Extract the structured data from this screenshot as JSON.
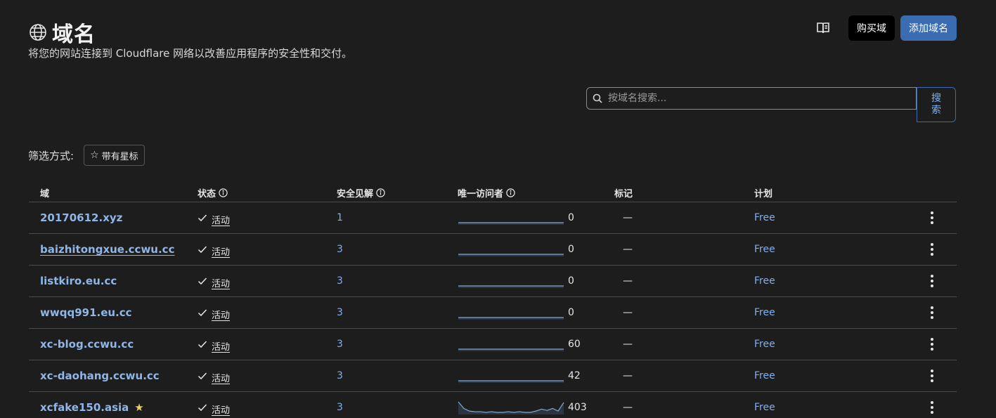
{
  "header": {
    "title": "域名",
    "subtitle": "将您的网站连接到 Cloudflare 网络以改善应用程序的安全性和交付。",
    "icon": "globe-icon",
    "docs_icon": "book-icon",
    "buy_domain_label": "购买域",
    "add_domain_label": "添加域名"
  },
  "search": {
    "placeholder": "按域名搜索...",
    "button_label": "搜索",
    "icon": "search-icon"
  },
  "filter": {
    "label": "筛选方式:",
    "chip_label": "带有星标"
  },
  "table": {
    "columns": {
      "domain": "域",
      "status": "状态",
      "insights": "安全见解",
      "visitors": "唯一访问者",
      "tags": "标记",
      "plan": "计划"
    },
    "rows": [
      {
        "domain": "20170612.xyz",
        "status": "活动",
        "insights": "1",
        "visitors": "0",
        "tags": "—",
        "plan": "Free",
        "starred": false,
        "underline": false,
        "spark": [
          0,
          0,
          0,
          0,
          0,
          0,
          0,
          0,
          0,
          0,
          0,
          0,
          0,
          0,
          0,
          0,
          0,
          0,
          0,
          0
        ]
      },
      {
        "domain": "baizhitongxue.ccwu.cc",
        "status": "活动",
        "insights": "3",
        "visitors": "0",
        "tags": "—",
        "plan": "Free",
        "starred": false,
        "underline": true,
        "spark": [
          0,
          0,
          0,
          0,
          0,
          0,
          0,
          0,
          0,
          0,
          0,
          0,
          0,
          0,
          0,
          0,
          0,
          0,
          0,
          0
        ]
      },
      {
        "domain": "listkiro.eu.cc",
        "status": "活动",
        "insights": "3",
        "visitors": "0",
        "tags": "—",
        "plan": "Free",
        "starred": false,
        "underline": false,
        "spark": [
          0,
          0,
          0,
          0,
          0,
          0,
          0,
          0,
          0,
          0,
          0,
          0,
          0,
          0,
          0,
          0,
          0,
          0,
          0,
          0
        ]
      },
      {
        "domain": "wwqq991.eu.cc",
        "status": "活动",
        "insights": "3",
        "visitors": "0",
        "tags": "—",
        "plan": "Free",
        "starred": false,
        "underline": false,
        "spark": [
          0,
          0,
          0,
          0,
          0,
          0,
          0,
          0,
          0,
          0,
          0,
          0,
          0,
          0,
          0,
          0,
          0,
          0,
          0,
          0
        ]
      },
      {
        "domain": "xc-blog.ccwu.cc",
        "status": "活动",
        "insights": "3",
        "visitors": "60",
        "tags": "—",
        "plan": "Free",
        "starred": false,
        "underline": false,
        "spark": [
          0,
          0,
          0,
          0,
          0,
          0,
          0,
          0,
          0,
          0,
          0,
          0,
          0,
          0,
          0,
          0,
          0,
          0,
          0,
          0
        ]
      },
      {
        "domain": "xc-daohang.ccwu.cc",
        "status": "活动",
        "insights": "3",
        "visitors": "42",
        "tags": "—",
        "plan": "Free",
        "starred": false,
        "underline": false,
        "spark": [
          0,
          0,
          0,
          0,
          0,
          0,
          0,
          0,
          0,
          0,
          0,
          0,
          0,
          0,
          0,
          0,
          0,
          0,
          0,
          0
        ]
      },
      {
        "domain": "xcfake150.asia",
        "status": "活动",
        "insights": "3",
        "visitors": "403",
        "tags": "—",
        "plan": "Free",
        "starred": true,
        "underline": false,
        "spark": [
          16,
          6,
          2,
          1,
          1,
          0,
          1,
          0,
          0,
          1,
          0,
          1,
          0,
          0,
          2,
          5,
          3,
          6,
          2,
          15
        ]
      }
    ]
  },
  "colors": {
    "background": "#1d1d1d",
    "accent_blue": "#3b6bb0",
    "link_blue": "#8fb6e6",
    "star_yellow": "#f0d060"
  }
}
